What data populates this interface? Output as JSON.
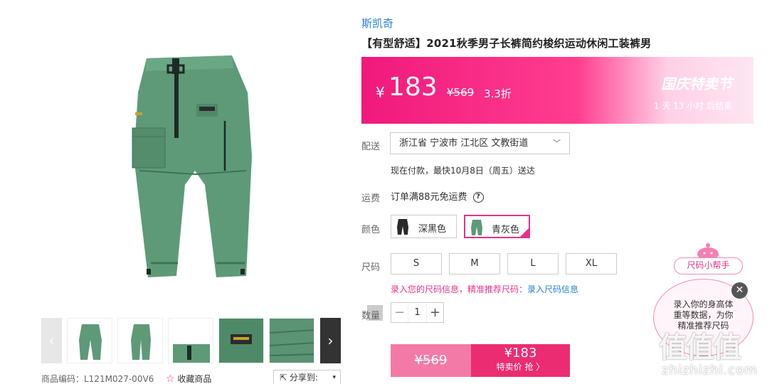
{
  "product": {
    "brand": "斯凯奇",
    "title": "【有型舒适】2021秋季男子长裤简约梭织运动休闲工装裤男",
    "code_label": "商品编码：L121M027-00V6",
    "favorite_label": "收藏商品",
    "share_label": "分享到:"
  },
  "promo": {
    "currency": "¥",
    "price": "183",
    "original_price": "¥569",
    "discount": "3.3折",
    "event_name": "国庆特卖节",
    "countdown": "1 天 13 小时 后结束"
  },
  "delivery": {
    "label": "配送",
    "address": "浙江省 宁波市 江北区 文教街道",
    "eta": "现在付款，最快10月8日（周五）送达"
  },
  "shipping": {
    "label": "运费",
    "text": "订单满88元免运费",
    "help_icon": "?"
  },
  "color": {
    "label": "颜色",
    "options": [
      {
        "name": "深黑色",
        "swatch": "#2a2a2a"
      },
      {
        "name": "青灰色",
        "swatch": "#5e9a78",
        "selected": true
      }
    ]
  },
  "size": {
    "label": "尺码",
    "options": [
      "S",
      "M",
      "L",
      "XL"
    ],
    "tip_text": "录入您的尺码信息，精准推荐尺码：",
    "tip_link": "录入尺码信息"
  },
  "quantity": {
    "label": "数量",
    "value": "1",
    "minus": "−",
    "plus": "+"
  },
  "buy": {
    "original_price": "¥569",
    "sale_price": "¥183",
    "sale_label": "特卖价 抢 〉"
  },
  "size_helper": {
    "button_label": "尺码小帮手",
    "bubble_text": "录入你的身高体重等数据，为你精准推荐尺码",
    "close": "✕"
  },
  "watermark": {
    "text": "值值值",
    "url": "zhizhizhi.com"
  },
  "colors": {
    "accent_pink": "#e8308a",
    "link_blue": "#2a7fd2",
    "pants_green": "#5e9a78"
  }
}
